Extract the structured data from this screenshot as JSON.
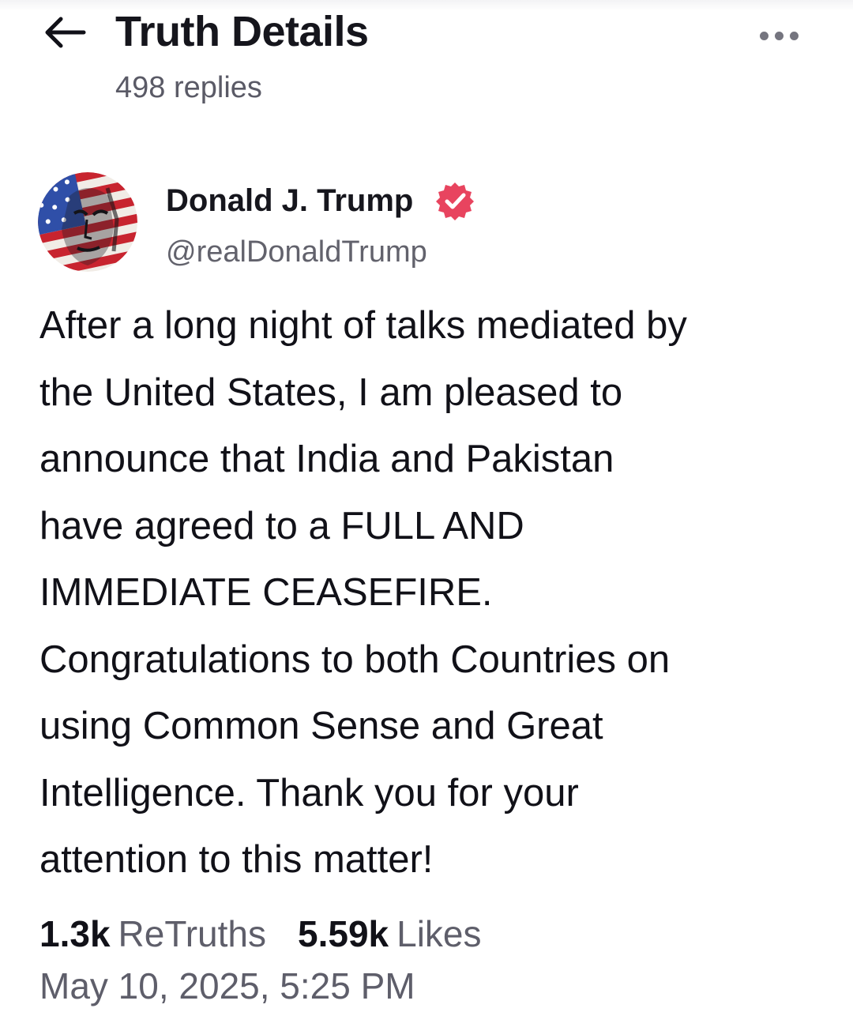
{
  "header": {
    "title": "Truth Details",
    "subtitle": "498 replies",
    "back_icon": "arrow-left-icon",
    "more_icon": "more-horizontal-icon"
  },
  "post": {
    "author": {
      "display_name": "Donald J. Trump",
      "handle": "@realDonaldTrump",
      "verified": true,
      "verified_icon": "verified-badge-icon",
      "verified_color": "#e8445f",
      "avatar": "american-flag-portrait-avatar"
    },
    "body_lines": [
      "After a long night of talks mediated by",
      "the United States, I am pleased to",
      "announce that India and Pakistan",
      "have agreed to a FULL AND",
      "IMMEDIATE CEASEFIRE.",
      "Congratulations to both Countries on",
      "using Common Sense and Great",
      "Intelligence. Thank you for your",
      "attention to this matter!"
    ],
    "stats": {
      "retruths_count": "1.3k",
      "retruths_label": "ReTruths",
      "likes_count": "5.59k",
      "likes_label": "Likes"
    },
    "timestamp": "May 10, 2025, 5:25 PM"
  },
  "colors": {
    "text_primary": "#111118",
    "text_secondary": "#5e5e6a",
    "background": "#ffffff",
    "accent": "#e8445f"
  }
}
